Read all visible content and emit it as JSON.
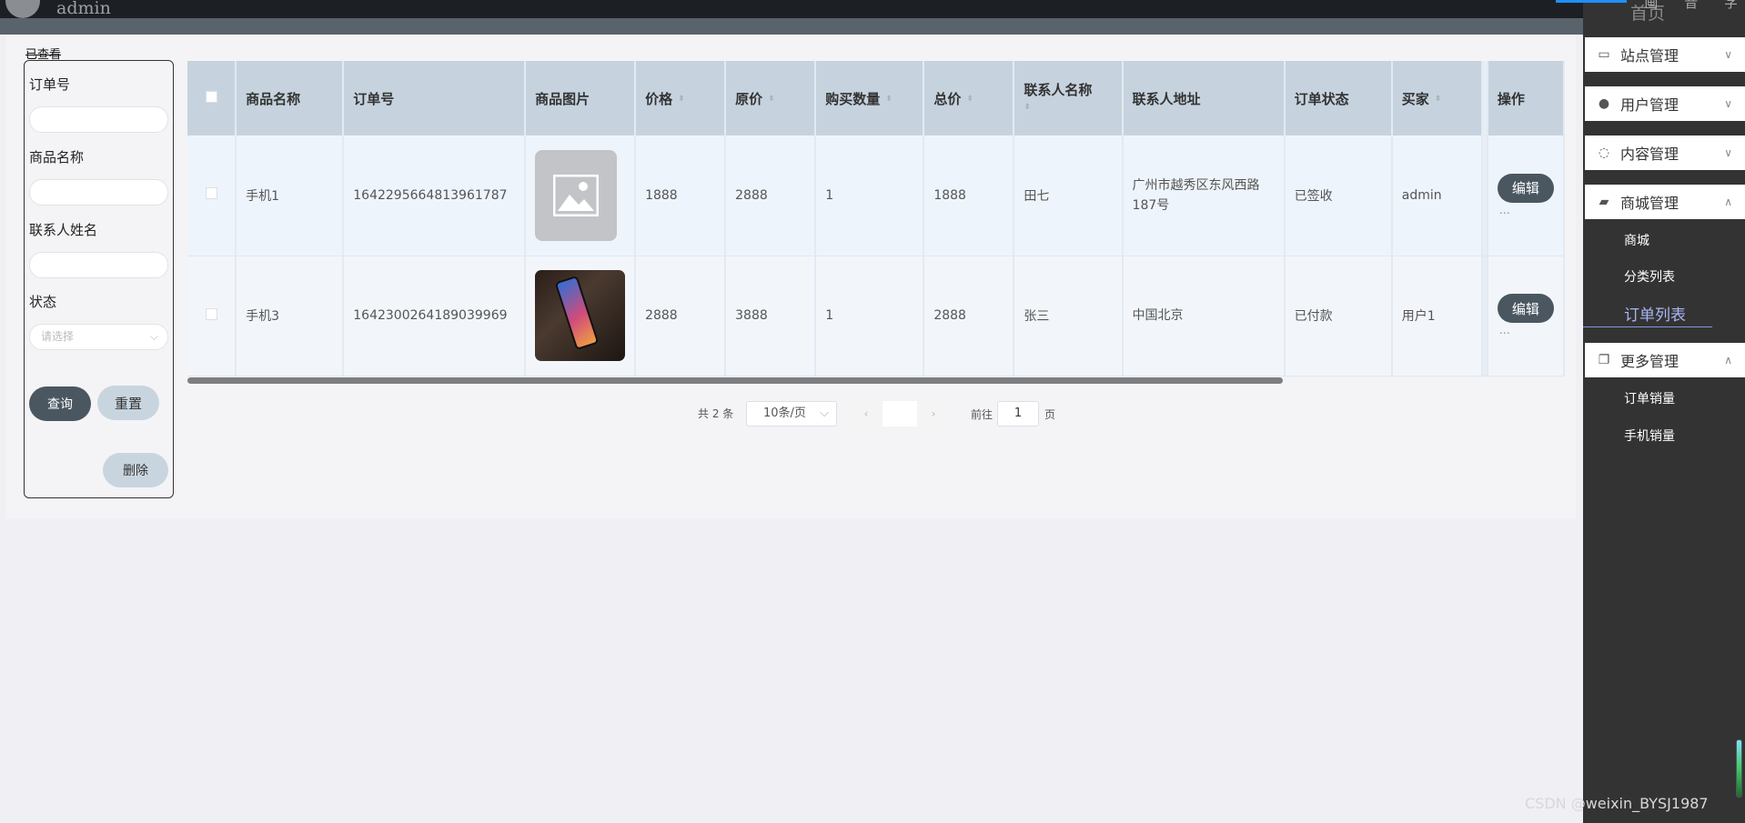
{
  "header": {
    "username": "admin"
  },
  "breadcrumb": "已查看",
  "search": {
    "order_no_label": "订单号",
    "product_name_label": "商品名称",
    "contact_name_label": "联系人姓名",
    "status_label": "状态",
    "status_placeholder": "请选择",
    "query_label": "查询",
    "reset_label": "重置",
    "delete_label": "删除"
  },
  "table": {
    "columns": {
      "product_name": "商品名称",
      "order_no": "订单号",
      "product_image": "商品图片",
      "price": "价格",
      "original_price": "原价",
      "quantity": "购买数量",
      "total": "总价",
      "contact_name": "联系人名称",
      "contact_address": "联系人地址",
      "order_status": "订单状态",
      "buyer": "买家",
      "actions": "操作"
    },
    "rows": [
      {
        "product_name": "手机1",
        "order_no": "1642295664813961787",
        "price": "1888",
        "original_price": "2888",
        "quantity": "1",
        "total": "1888",
        "contact_name": "田七",
        "contact_address": "广州市越秀区东风西路187号",
        "order_status": "已签收",
        "buyer": "admin",
        "edit_label": "编辑"
      },
      {
        "product_name": "手机3",
        "order_no": "1642300264189039969",
        "price": "2888",
        "original_price": "3888",
        "quantity": "1",
        "total": "2888",
        "contact_name": "张三",
        "contact_address": "中国北京",
        "order_status": "已付款",
        "buyer": "用户1",
        "edit_label": "编辑"
      }
    ]
  },
  "pagination": {
    "total_text": "共 2 条",
    "page_size": "10条/页",
    "goto_label": "前往",
    "goto_value": "1",
    "page_unit": "页"
  },
  "sidebar": {
    "home": "首页",
    "top_links": [
      "画",
      "音",
      "字"
    ],
    "menus": [
      {
        "label": "站点管理",
        "icon": "monitor-icon"
      },
      {
        "label": "用户管理",
        "icon": "user-icon"
      },
      {
        "label": "内容管理",
        "icon": "chat-icon"
      },
      {
        "label": "商城管理",
        "icon": "bag-icon"
      },
      {
        "label": "更多管理",
        "icon": "copy-icon"
      }
    ],
    "mall_items": [
      "商城",
      "分类列表",
      "订单列表"
    ],
    "more_items": [
      "订单销量",
      "手机销量"
    ]
  },
  "watermark": "CSDN @weixin_BYSJ1987",
  "colors": {
    "accent": "#4a5761",
    "sidebar_bg": "#333334",
    "active_menu": "#a8b6f0"
  }
}
